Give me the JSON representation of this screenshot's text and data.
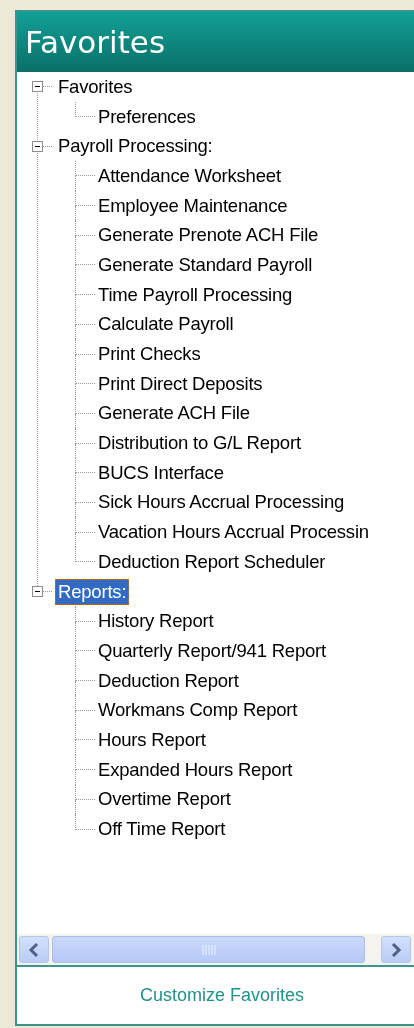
{
  "header": {
    "title": "Favorites"
  },
  "tree": [
    {
      "label": "Favorites",
      "expanded": true,
      "selected": false,
      "children": [
        {
          "label": "Preferences",
          "selected": false
        }
      ]
    },
    {
      "label": "Payroll Processing:",
      "expanded": true,
      "selected": false,
      "children": [
        {
          "label": "Attendance Worksheet",
          "selected": false
        },
        {
          "label": "Employee Maintenance",
          "selected": false
        },
        {
          "label": "Generate Prenote ACH File",
          "selected": false
        },
        {
          "label": "Generate Standard Payroll",
          "selected": false
        },
        {
          "label": "Time Payroll Processing",
          "selected": false
        },
        {
          "label": "Calculate Payroll",
          "selected": false
        },
        {
          "label": "Print Checks",
          "selected": false
        },
        {
          "label": "Print Direct Deposits",
          "selected": false
        },
        {
          "label": "Generate ACH File",
          "selected": false
        },
        {
          "label": "Distribution to G/L Report",
          "selected": false
        },
        {
          "label": "BUCS Interface",
          "selected": false
        },
        {
          "label": "Sick Hours Accrual Processing",
          "selected": false
        },
        {
          "label": "Vacation Hours Accrual Processin",
          "selected": false
        },
        {
          "label": "Deduction Report Scheduler",
          "selected": false
        }
      ]
    },
    {
      "label": "Reports:",
      "expanded": true,
      "selected": true,
      "children": [
        {
          "label": "History Report",
          "selected": false
        },
        {
          "label": "Quarterly Report/941 Report",
          "selected": false
        },
        {
          "label": "Deduction Report",
          "selected": false
        },
        {
          "label": "Workmans Comp Report",
          "selected": false
        },
        {
          "label": "Hours Report",
          "selected": false
        },
        {
          "label": "Expanded Hours Report",
          "selected": false
        },
        {
          "label": "Overtime Report",
          "selected": false
        },
        {
          "label": "Off Time Report",
          "selected": false
        }
      ]
    }
  ],
  "footer": {
    "link": "Customize Favorites"
  }
}
